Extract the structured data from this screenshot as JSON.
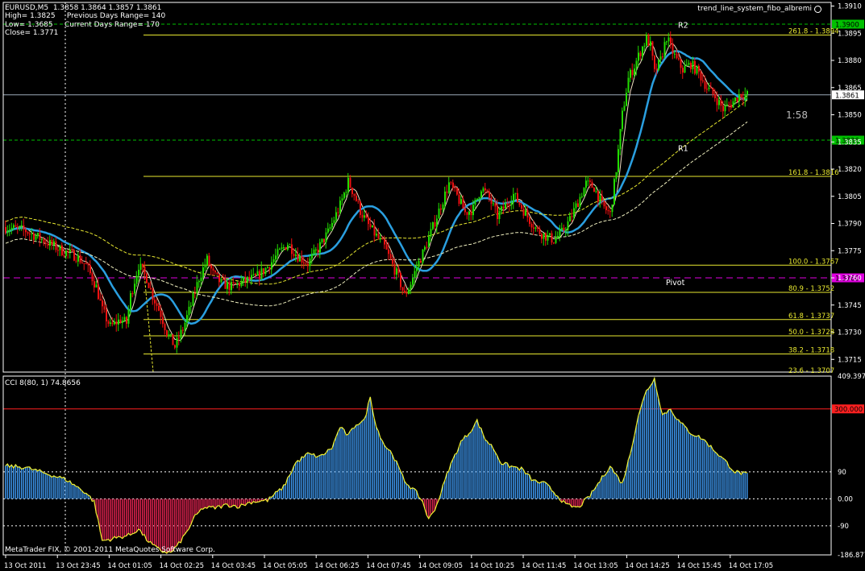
{
  "symbol_line": "EURUSD,M5  1.3858 1.3864 1.3857 1.3861",
  "stats": {
    "high": "High= 1.3825",
    "prev_range": "Previous Days Range= 140",
    "low": "Low= 1.3685",
    "curr_range": "Current Days Range= 170",
    "close": "Close= 1.3771"
  },
  "indicator_name": "trend_line_system_fibo_albremi",
  "timer": "1:58",
  "cci_label": "CCI 8(80, 1) 74.8656",
  "footer": "MetaTrader FIX, © 2001-2011 MetaQuotes Software Corp.",
  "colors": {
    "bull": "#22dd00",
    "bear": "#ee1111",
    "ma_fast": "#2a9fe0",
    "fibo": "#e8e830",
    "pivot": "#e000e0",
    "level_green": "#00c000",
    "cci_pos": "#3a8ee0",
    "cci_neg": "#d0204a",
    "cci_line": "#f0f030"
  },
  "chart_data": [
    {
      "type": "candlestick",
      "title": "EURUSD,M5",
      "ylim": [
        1.3708,
        1.3912
      ],
      "y_ticks": [
        "1.3910",
        "1.3895",
        "1.3880",
        "1.3865",
        "1.3850",
        "1.3835",
        "1.3820",
        "1.3805",
        "1.3790",
        "1.3775",
        "1.3760",
        "1.3745",
        "1.3730",
        "1.3715"
      ],
      "x_ticks": [
        "13 Oct 2011",
        "13 Oct 23:45",
        "14 Oct 01:05",
        "14 Oct 02:25",
        "14 Oct 03:45",
        "14 Oct 05:05",
        "14 Oct 06:25",
        "14 Oct 07:45",
        "14 Oct 09:05",
        "14 Oct 10:25",
        "14 Oct 11:45",
        "14 Oct 13:05",
        "14 Oct 14:25",
        "14 Oct 15:45",
        "14 Oct 17:05"
      ],
      "price_path": [
        [
          0,
          1.3788
        ],
        [
          10,
          1.3786
        ],
        [
          20,
          1.378
        ],
        [
          28,
          1.3775
        ],
        [
          35,
          1.3772
        ],
        [
          40,
          1.3767
        ],
        [
          45,
          1.3755
        ],
        [
          48,
          1.3742
        ],
        [
          52,
          1.3733
        ],
        [
          57,
          1.3737
        ],
        [
          60,
          1.3735
        ],
        [
          62,
          1.375
        ],
        [
          66,
          1.3767
        ],
        [
          70,
          1.376
        ],
        [
          73,
          1.375
        ],
        [
          77,
          1.374
        ],
        [
          80,
          1.373
        ],
        [
          84,
          1.3722
        ],
        [
          88,
          1.3732
        ],
        [
          92,
          1.3745
        ],
        [
          96,
          1.376
        ],
        [
          100,
          1.377
        ],
        [
          103,
          1.3762
        ],
        [
          107,
          1.3757
        ],
        [
          112,
          1.3755
        ],
        [
          118,
          1.3758
        ],
        [
          124,
          1.376
        ],
        [
          130,
          1.3766
        ],
        [
          135,
          1.3773
        ],
        [
          140,
          1.3779
        ],
        [
          145,
          1.3772
        ],
        [
          150,
          1.3768
        ],
        [
          155,
          1.3776
        ],
        [
          160,
          1.3785
        ],
        [
          166,
          1.38
        ],
        [
          170,
          1.3813
        ],
        [
          173,
          1.3806
        ],
        [
          176,
          1.3797
        ],
        [
          180,
          1.3789
        ],
        [
          184,
          1.3783
        ],
        [
          188,
          1.3777
        ],
        [
          192,
          1.3767
        ],
        [
          195,
          1.376
        ],
        [
          198,
          1.375
        ],
        [
          201,
          1.3757
        ],
        [
          204,
          1.3766
        ],
        [
          208,
          1.3776
        ],
        [
          212,
          1.3788
        ],
        [
          216,
          1.38
        ],
        [
          220,
          1.3812
        ],
        [
          224,
          1.3805
        ],
        [
          228,
          1.3796
        ],
        [
          232,
          1.3798
        ],
        [
          236,
          1.381
        ],
        [
          240,
          1.3804
        ],
        [
          244,
          1.3794
        ],
        [
          248,
          1.38
        ],
        [
          252,
          1.3806
        ],
        [
          256,
          1.3799
        ],
        [
          260,
          1.3792
        ],
        [
          264,
          1.3786
        ],
        [
          268,
          1.3783
        ],
        [
          272,
          1.3781
        ],
        [
          276,
          1.3785
        ],
        [
          280,
          1.3792
        ],
        [
          284,
          1.3802
        ],
        [
          288,
          1.3812
        ],
        [
          292,
          1.381
        ],
        [
          296,
          1.38
        ],
        [
          300,
          1.3795
        ],
        [
          303,
          1.382
        ],
        [
          306,
          1.385
        ],
        [
          309,
          1.387
        ],
        [
          312,
          1.3877
        ],
        [
          315,
          1.3885
        ],
        [
          318,
          1.3892
        ],
        [
          320,
          1.3888
        ],
        [
          322,
          1.3873
        ],
        [
          325,
          1.388
        ],
        [
          328,
          1.3893
        ],
        [
          330,
          1.3887
        ],
        [
          333,
          1.388
        ],
        [
          336,
          1.3875
        ],
        [
          340,
          1.3878
        ],
        [
          344,
          1.3873
        ],
        [
          348,
          1.3865
        ],
        [
          352,
          1.386
        ],
        [
          356,
          1.3853
        ],
        [
          360,
          1.3856
        ],
        [
          364,
          1.3861
        ]
      ],
      "fibo_levels": [
        {
          "label": "261.8 - 1.3894",
          "value": 1.3894
        },
        {
          "label": "161.8 - 1.3816",
          "value": 1.3816
        },
        {
          "label": "100.0 - 1.3767",
          "value": 1.3767
        },
        {
          "label": "80.9 - 1.3752",
          "value": 1.3752
        },
        {
          "label": "61.8 - 1.3737",
          "value": 1.3737
        },
        {
          "label": "50.0 - 1.3728",
          "value": 1.3728
        },
        {
          "label": "38.2 - 1.3718",
          "value": 1.3718
        }
      ],
      "fibo_partial_label": "23.6 - 1.3707",
      "price_levels": [
        {
          "label": "1.3900",
          "value": 1.39,
          "kind": "resistance"
        },
        {
          "label": "1.3861",
          "value": 1.3861,
          "kind": "current"
        },
        {
          "label": "1.3836",
          "value": 1.3836,
          "kind": "resistance"
        },
        {
          "label": "1.3760",
          "value": 1.376,
          "kind": "pivot"
        }
      ],
      "annotations": [
        {
          "text": "R2",
          "x": 334,
          "y": 1.3898
        },
        {
          "text": "R1",
          "x": 334,
          "y": 1.383
        },
        {
          "text": "Pivot",
          "x": 328,
          "y": 1.3756
        }
      ]
    },
    {
      "type": "bar",
      "title": "CCI 8(80, 1) 74.8656",
      "ylim": [
        -186.877,
        409.397
      ],
      "y_ticks": [
        "409.397",
        "300.000",
        "90",
        "0.00",
        "-90",
        "-186.877"
      ],
      "levels": [
        300,
        90,
        0,
        -90
      ],
      "cci_path": [
        [
          0,
          110
        ],
        [
          10,
          105
        ],
        [
          20,
          85
        ],
        [
          30,
          65
        ],
        [
          40,
          20
        ],
        [
          44,
          -10
        ],
        [
          48,
          -140
        ],
        [
          55,
          -130
        ],
        [
          62,
          -120
        ],
        [
          66,
          -100
        ],
        [
          70,
          -135
        ],
        [
          74,
          -160
        ],
        [
          78,
          -175
        ],
        [
          82,
          -180
        ],
        [
          86,
          -150
        ],
        [
          90,
          -110
        ],
        [
          94,
          -60
        ],
        [
          98,
          -30
        ],
        [
          104,
          -30
        ],
        [
          110,
          -20
        ],
        [
          116,
          -25
        ],
        [
          122,
          -10
        ],
        [
          130,
          -5
        ],
        [
          138,
          40
        ],
        [
          144,
          120
        ],
        [
          150,
          150
        ],
        [
          156,
          140
        ],
        [
          162,
          170
        ],
        [
          166,
          240
        ],
        [
          170,
          210
        ],
        [
          174,
          250
        ],
        [
          178,
          260
        ],
        [
          181,
          340
        ],
        [
          184,
          240
        ],
        [
          188,
          180
        ],
        [
          192,
          150
        ],
        [
          198,
          60
        ],
        [
          204,
          20
        ],
        [
          207,
          -10
        ],
        [
          210,
          -70
        ],
        [
          214,
          -20
        ],
        [
          220,
          100
        ],
        [
          226,
          190
        ],
        [
          230,
          220
        ],
        [
          234,
          260
        ],
        [
          238,
          200
        ],
        [
          242,
          170
        ],
        [
          246,
          120
        ],
        [
          250,
          110
        ],
        [
          256,
          100
        ],
        [
          262,
          60
        ],
        [
          268,
          50
        ],
        [
          274,
          10
        ],
        [
          278,
          -20
        ],
        [
          284,
          -30
        ],
        [
          290,
          10
        ],
        [
          296,
          70
        ],
        [
          300,
          110
        ],
        [
          302,
          90
        ],
        [
          306,
          50
        ],
        [
          310,
          150
        ],
        [
          314,
          280
        ],
        [
          318,
          360
        ],
        [
          322,
          400
        ],
        [
          326,
          280
        ],
        [
          330,
          300
        ],
        [
          334,
          260
        ],
        [
          340,
          220
        ],
        [
          346,
          200
        ],
        [
          352,
          160
        ],
        [
          358,
          120
        ],
        [
          362,
          90
        ],
        [
          366,
          85
        ],
        [
          370,
          75
        ]
      ]
    }
  ]
}
